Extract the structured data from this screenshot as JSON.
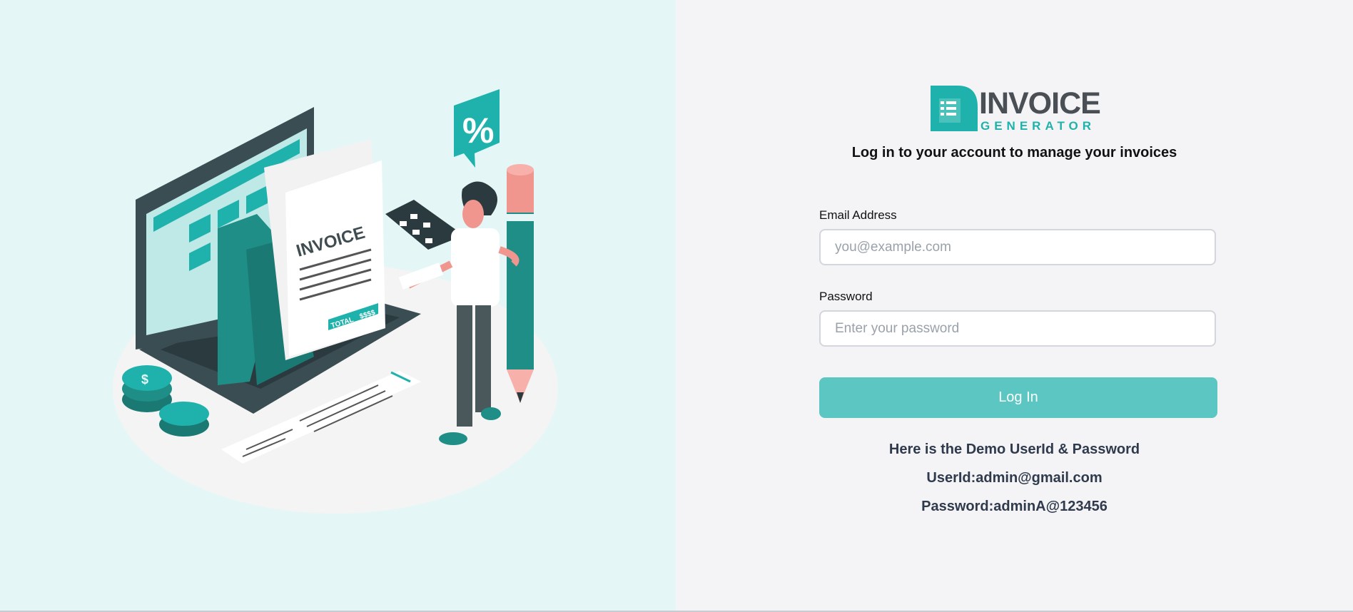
{
  "logo": {
    "word": "INVOICE",
    "sub": "GENERATOR",
    "colors": {
      "primary": "#1fb2ac",
      "dark": "#4a4f55"
    }
  },
  "illustration": {
    "invoice_heading": "INVOICE",
    "total_label": "TOTAL",
    "total_amount": "$$$$",
    "badge_symbol": "%",
    "coin_symbol": "$"
  },
  "login": {
    "subtitle": "Log in to your account to manage your invoices",
    "email_label": "Email Address",
    "email_placeholder": "you@example.com",
    "password_label": "Password",
    "password_placeholder": "Enter your password",
    "button_label": "Log In"
  },
  "demo": {
    "heading": "Here is the Demo UserId & Password",
    "userid": "UserId:admin@gmail.com",
    "password": "Password:adminA@123456"
  },
  "colors": {
    "left_bg": "#e4f7f6",
    "right_bg": "#f4f4f6",
    "button": "#5cc7c2",
    "teal": "#1fb2ac"
  }
}
